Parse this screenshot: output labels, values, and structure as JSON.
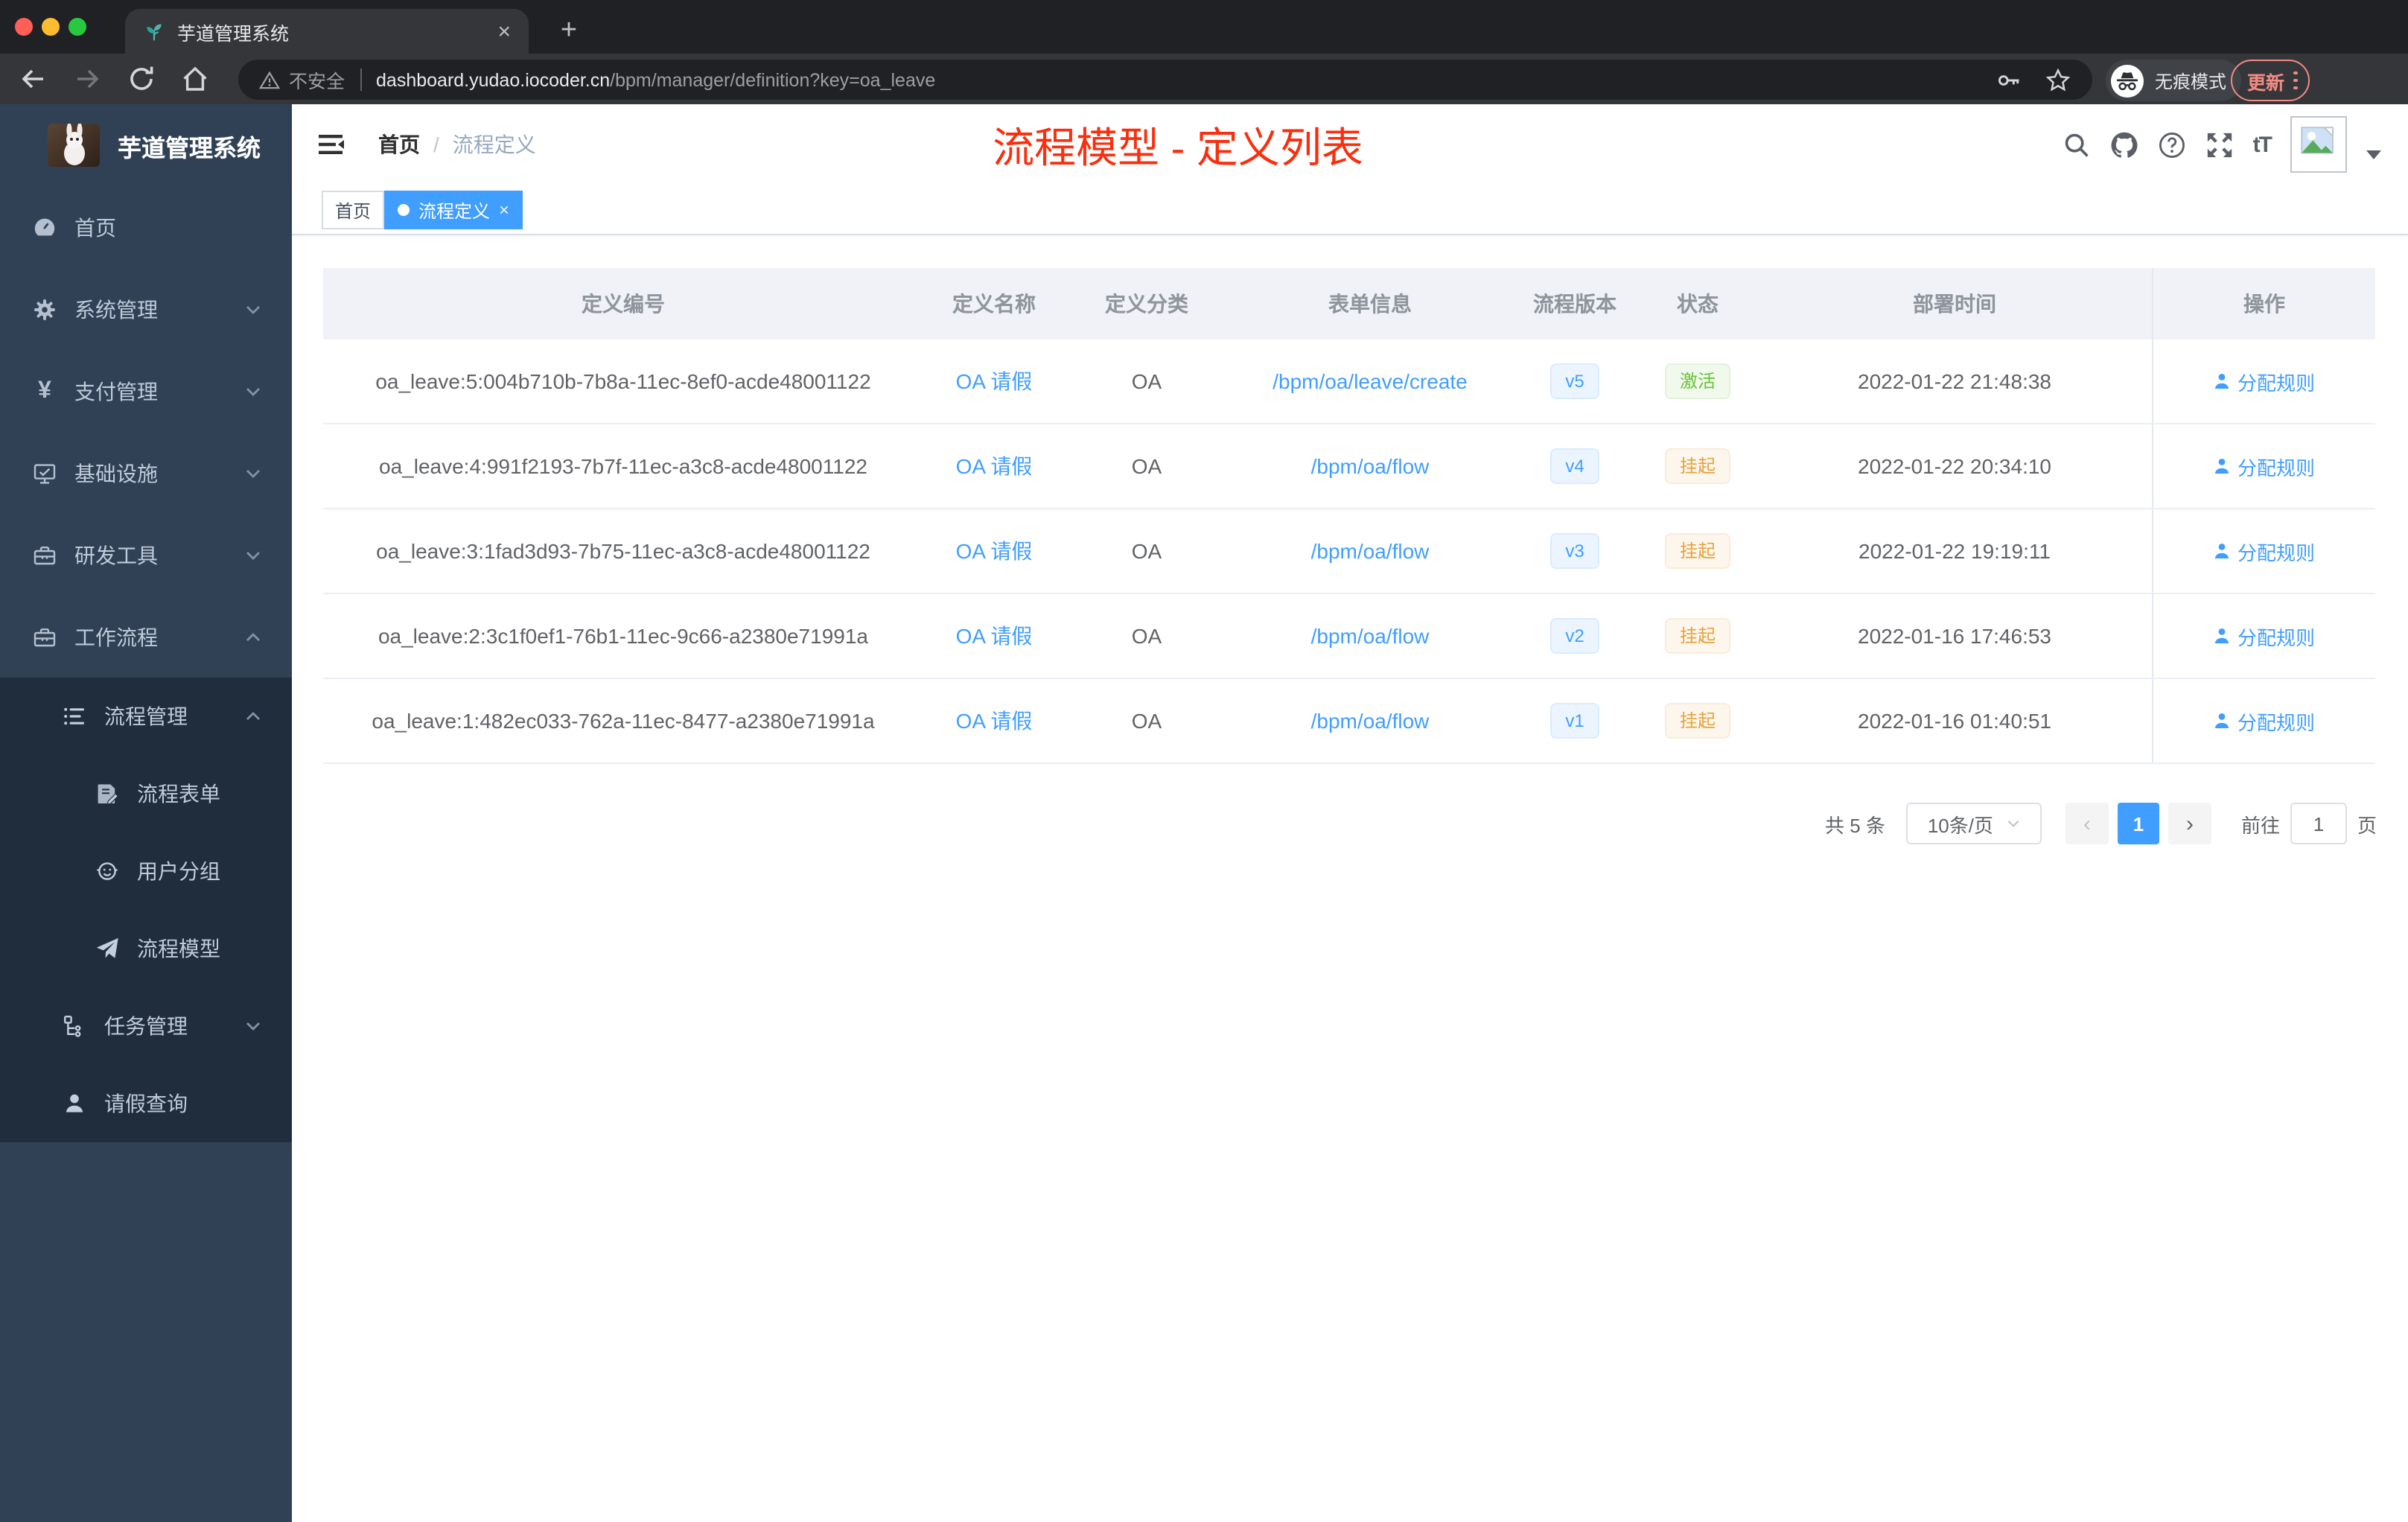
{
  "browser": {
    "tab": {
      "title": "芋道管理系统",
      "close_glyph": "×",
      "new_tab_glyph": "+"
    },
    "address": {
      "security": "不安全",
      "domain": "dashboard.yudao.iocoder.cn",
      "path": "/bpm/manager/definition?key=oa_leave"
    },
    "incognito_label": "无痕模式",
    "update_button": "更新"
  },
  "sidebar": {
    "logo_title": "芋道管理系统",
    "menu": [
      {
        "label": "首页",
        "icon": "dashboard-icon"
      },
      {
        "label": "系统管理",
        "icon": "gear-icon",
        "chevron": "down"
      },
      {
        "label": "支付管理",
        "icon": "yen-icon",
        "chevron": "down",
        "yen_glyph": "¥"
      },
      {
        "label": "基础设施",
        "icon": "monitor-icon",
        "chevron": "down"
      },
      {
        "label": "研发工具",
        "icon": "toolbox-icon",
        "chevron": "down"
      },
      {
        "label": "工作流程",
        "icon": "briefcase-icon",
        "chevron": "up"
      }
    ],
    "submenu": [
      {
        "label": "流程管理",
        "icon": "flow-list-icon",
        "chevron": "up",
        "level": 1
      },
      {
        "label": "流程表单",
        "icon": "form-icon",
        "level": 2
      },
      {
        "label": "用户分组",
        "icon": "user-group-icon",
        "level": 2
      },
      {
        "label": "流程模型",
        "icon": "paper-plane-icon",
        "level": 2
      },
      {
        "label": "任务管理",
        "icon": "task-tree-icon",
        "chevron": "down",
        "level": 1
      },
      {
        "label": "请假查询",
        "icon": "person-icon",
        "level": 1
      }
    ]
  },
  "navbar": {
    "breadcrumb": {
      "home": "首页",
      "separator": "/",
      "current": "流程定义"
    },
    "annotation": {
      "text": "流程模型 - 定义列表",
      "color": "#fb2e0d"
    }
  },
  "tags": [
    {
      "label": "首页",
      "active": false
    },
    {
      "label": "流程定义",
      "active": true,
      "close_glyph": "×"
    }
  ],
  "table": {
    "columns": [
      "定义编号",
      "定义名称",
      "定义分类",
      "表单信息",
      "流程版本",
      "状态",
      "部署时间",
      "操作"
    ],
    "rows": [
      {
        "id": "oa_leave:5:004b710b-7b8a-11ec-8ef0-acde48001122",
        "name": "OA 请假",
        "category": "OA",
        "form": "/bpm/oa/leave/create",
        "version": "v5",
        "status": "激活",
        "status_type": "success",
        "time": "2022-01-22 21:48:38",
        "action": "分配规则"
      },
      {
        "id": "oa_leave:4:991f2193-7b7f-11ec-a3c8-acde48001122",
        "name": "OA 请假",
        "category": "OA",
        "form": "/bpm/oa/flow",
        "version": "v4",
        "status": "挂起",
        "status_type": "warning",
        "time": "2022-01-22 20:34:10",
        "action": "分配规则"
      },
      {
        "id": "oa_leave:3:1fad3d93-7b75-11ec-a3c8-acde48001122",
        "name": "OA 请假",
        "category": "OA",
        "form": "/bpm/oa/flow",
        "version": "v3",
        "status": "挂起",
        "status_type": "warning",
        "time": "2022-01-22 19:19:11",
        "action": "分配规则"
      },
      {
        "id": "oa_leave:2:3c1f0ef1-76b1-11ec-9c66-a2380e71991a",
        "name": "OA 请假",
        "category": "OA",
        "form": "/bpm/oa/flow",
        "version": "v2",
        "status": "挂起",
        "status_type": "warning",
        "time": "2022-01-16 17:46:53",
        "action": "分配规则"
      },
      {
        "id": "oa_leave:1:482ec033-762a-11ec-8477-a2380e71991a",
        "name": "OA 请假",
        "category": "OA",
        "form": "/bpm/oa/flow",
        "version": "v1",
        "status": "挂起",
        "status_type": "warning",
        "time": "2022-01-16 01:40:51",
        "action": "分配规则"
      }
    ]
  },
  "pagination": {
    "total": "共 5 条",
    "page_size": "10条/页",
    "prev_glyph": "‹",
    "current_page": "1",
    "next_glyph": "›",
    "goto_label": "前往",
    "goto_value": "1",
    "unit_label": "页"
  },
  "colors": {
    "accent": "#409eff",
    "success": "#67c23a",
    "warning": "#e6a23c",
    "sidebar_bg": "#304156",
    "submenu_bg": "#1f2d3d",
    "annotation_red": "#fb2e0d"
  }
}
